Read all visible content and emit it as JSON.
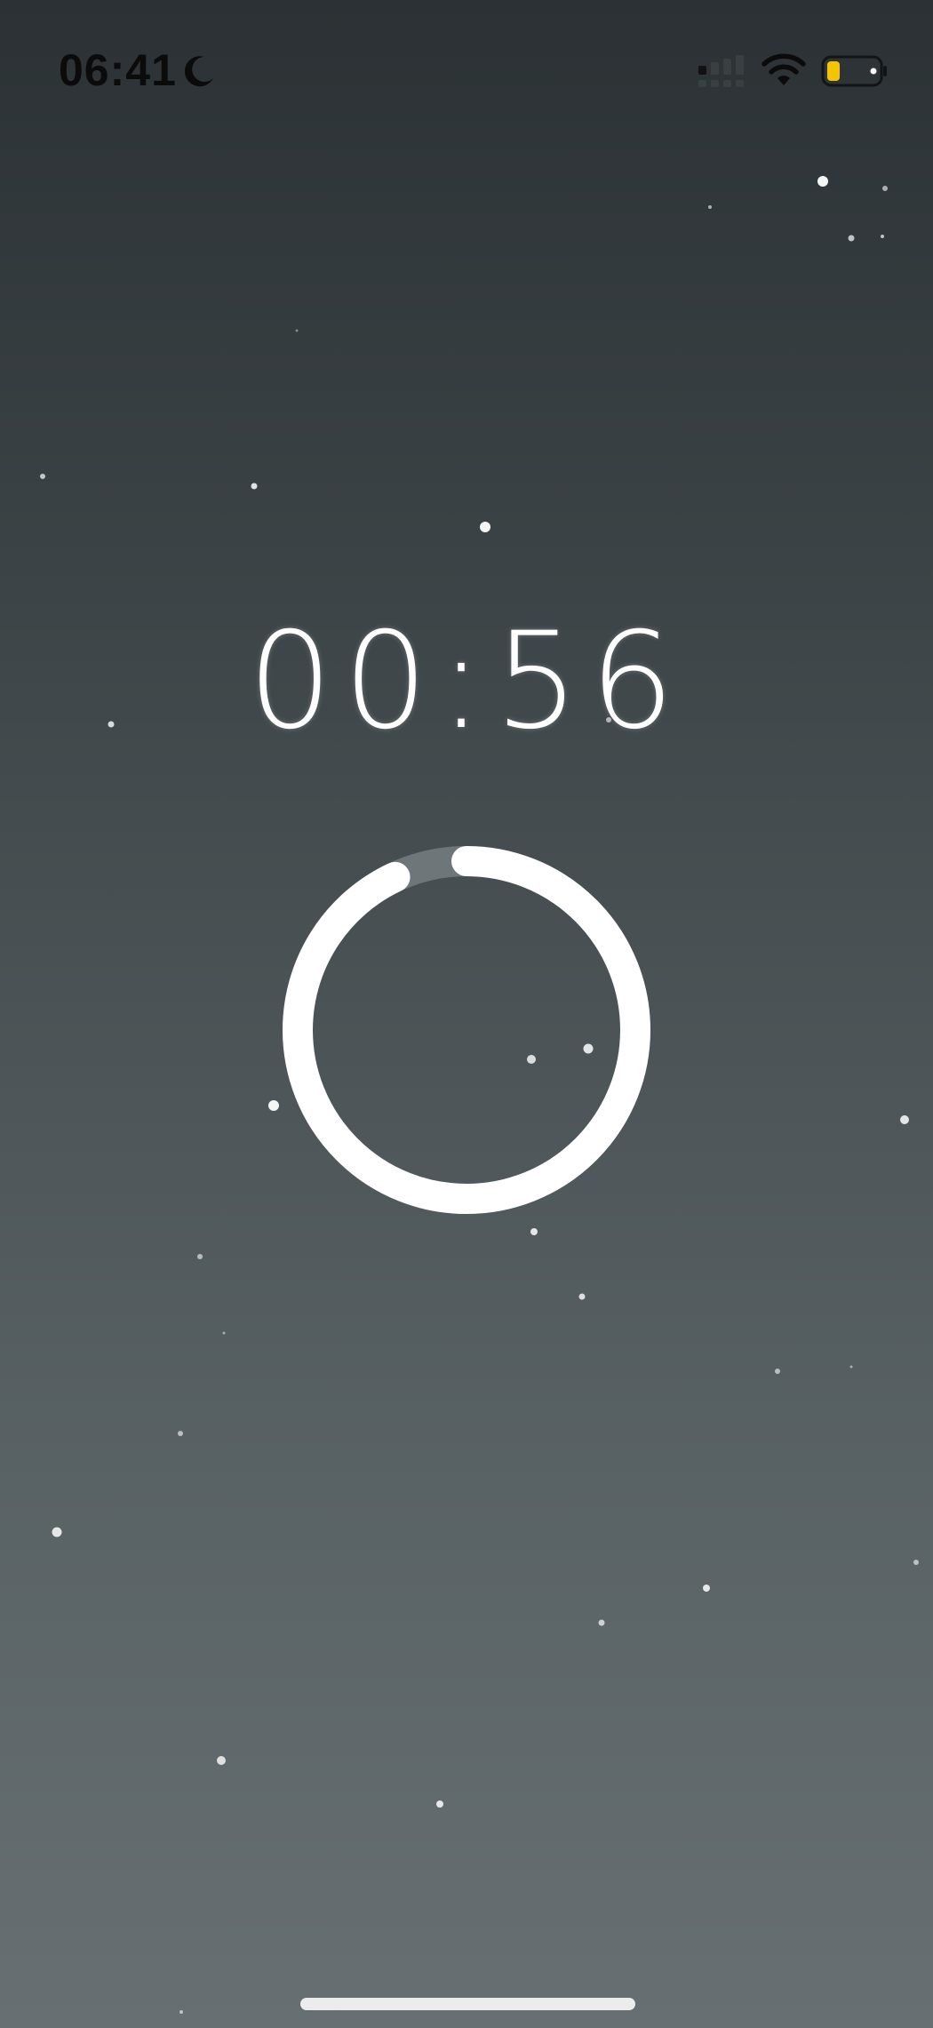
{
  "status_bar": {
    "time": "06:41",
    "focus_icon": "moon-icon",
    "signal_icon": "cellular-signal-icon",
    "wifi_icon": "wifi-icon",
    "battery_icon": "battery-icon",
    "battery_mode": "low-power",
    "battery_color": "#f5c400"
  },
  "timer": {
    "display": "00:56",
    "progress_fraction": 0.93,
    "ring_color": "#ffffff",
    "track_color": "#6f7679"
  },
  "background": {
    "gradient_top": "#2b3134",
    "gradient_bottom": "#676f72"
  }
}
